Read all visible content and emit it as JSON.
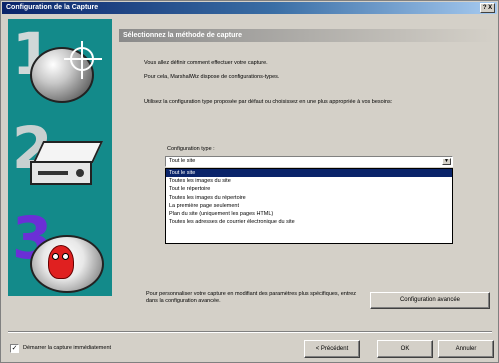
{
  "window": {
    "title": "Configuration de la Capture",
    "help_label": "? X"
  },
  "steps": [
    "1",
    "2",
    "3"
  ],
  "header": {
    "title": "Sélectionnez la méthode de capture"
  },
  "intro": {
    "line1": "Vous allez définir comment effectuer votre capture.",
    "line2": "Pour cela, MarshalWiz dispose de configurations-types.",
    "line3": "Utilisez la configuration type proposée par défaut ou choisissez en une plus appropriée à vos besoins:"
  },
  "combo": {
    "label": "Configuration type :",
    "value": "Tout le site",
    "arrow": "▼"
  },
  "dropdown": {
    "items": [
      "Tout le site",
      "Toutes les images du site",
      "Tout le répertoire",
      "Toutes les images du répertoire",
      "La première page seulement",
      "Plan du site (uniquement les pages HTML)",
      "Toutes les adresses de courrier électronique du site"
    ],
    "selected_index": 0
  },
  "customize": {
    "text": "Pour personnaliser votre capture en modifiant des paramètres plus spécifiques, entrez dans la configuration avancée.",
    "advanced_button": "Configuration avancée"
  },
  "footer": {
    "checkbox_checked": true,
    "checkbox_mark": "✓",
    "checkbox_label": "Démarrer la capture immédiatement",
    "prev_button": "< Précédent",
    "ok_button": "OK",
    "cancel_button": "Annuler"
  },
  "colors": {
    "title_bar": "#0a246a",
    "left_panel": "#138a8a",
    "dialog_bg": "#d4d0c8",
    "selection": "#0a246a",
    "step3_number": "#6b2fd6"
  }
}
